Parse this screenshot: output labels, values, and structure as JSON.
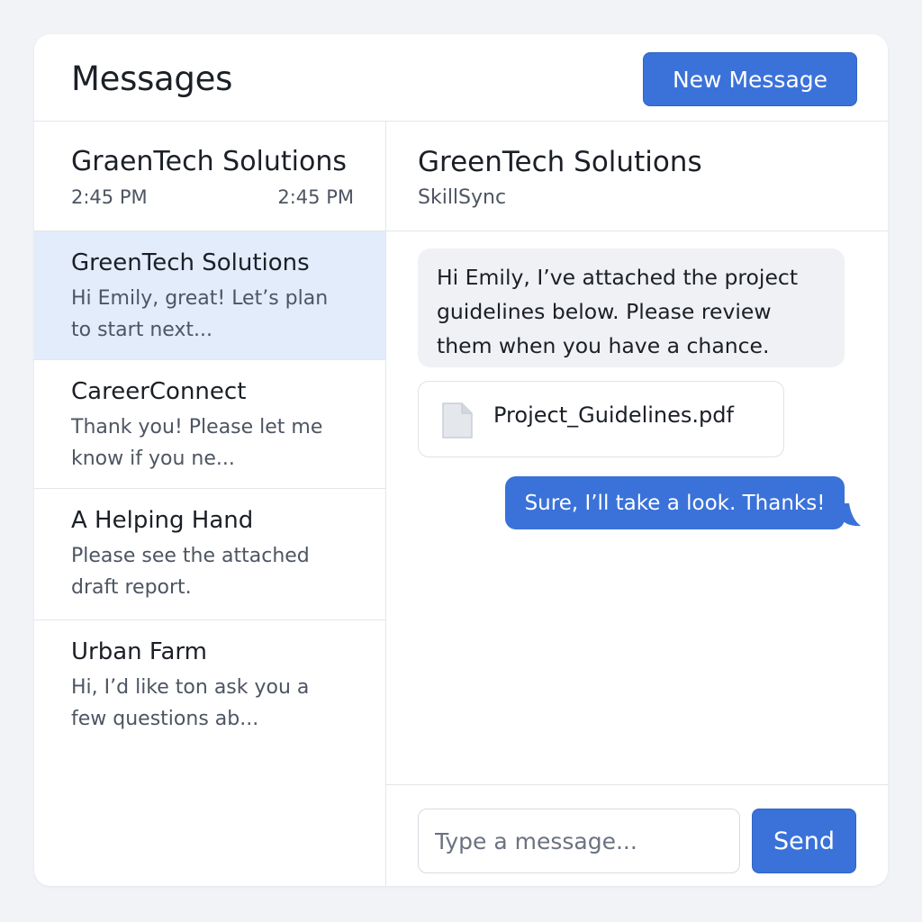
{
  "header": {
    "title": "Messages",
    "new_message_label": "New Message"
  },
  "sidebar": {
    "head": {
      "name": "GraenTech Solutions",
      "time_left": "2:45 PM",
      "time_right": "2:45 PM"
    },
    "conversations": [
      {
        "name": "GreenTech Solutions",
        "preview": "Hi Emily, great! Let’s plan to start next...",
        "active": true
      },
      {
        "name": "CareerConnect",
        "preview": "Thank you! Please let me know if you ne...",
        "active": false
      },
      {
        "name": "A Helping Hand",
        "preview": "Please see the attached draft report.",
        "active": false
      },
      {
        "name": "Urban Farm",
        "preview": "Hi, I’d like ton ask you a few questions ab...",
        "active": false
      }
    ]
  },
  "chat": {
    "title": "GreenTech Solutions",
    "subtitle": "SkillSync",
    "messages": {
      "incoming": "Hi Emily, I’ve attached the project guidelines below. Please review them when you have a chance.",
      "attachment_name": "Project_Guidelines.pdf",
      "outgoing": "Sure, I’ll take a look. Thanks!"
    },
    "composer": {
      "placeholder": "Type a message...",
      "send_label": "Send"
    }
  },
  "icons": {
    "attachment": "file-icon"
  },
  "colors": {
    "accent": "#3a72d9",
    "active_row": "#e2ecfb",
    "incoming_bubble": "#f0f1f4",
    "page_background": "#f1f3f7"
  }
}
